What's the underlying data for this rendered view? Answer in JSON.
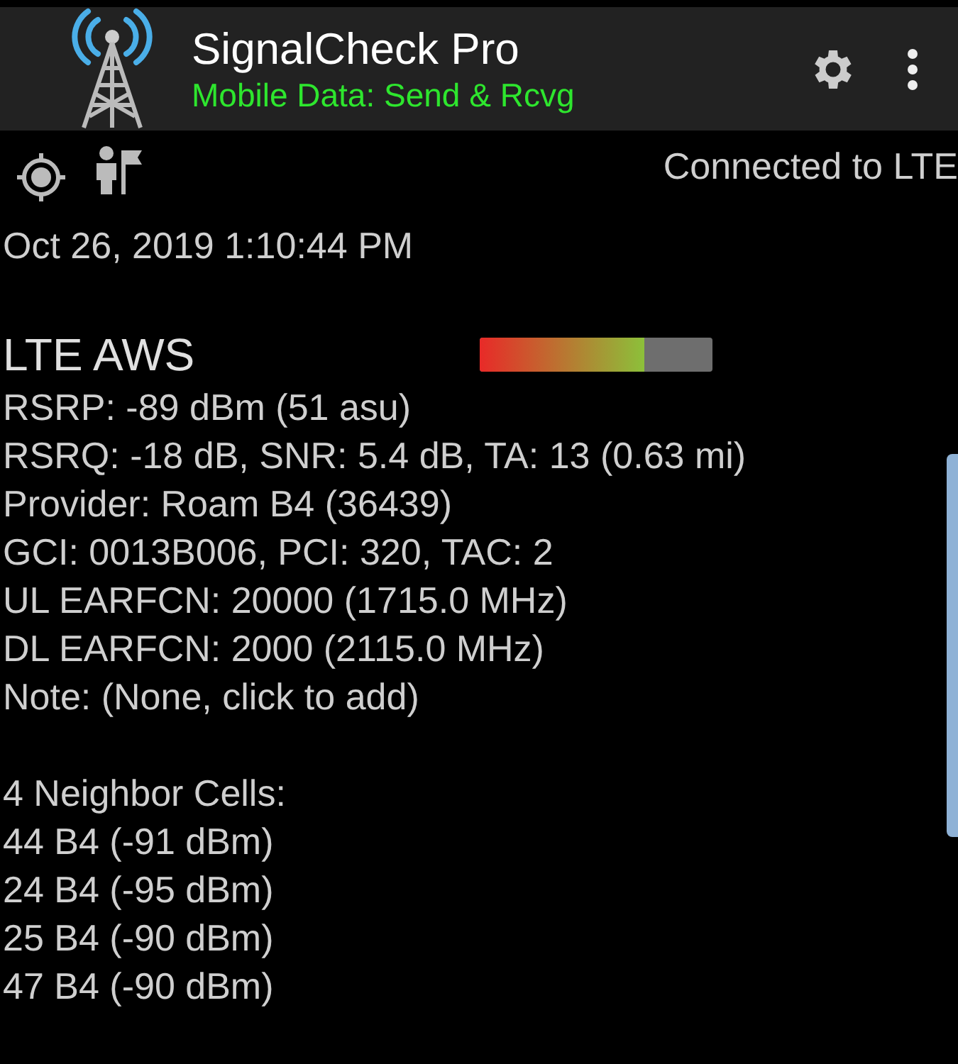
{
  "app_bar": {
    "title": "SignalCheck Pro",
    "subtitle": "Mobile Data: Send & Rcvg"
  },
  "status": {
    "connection": "Connected to LTE",
    "timestamp": "Oct 26, 2019 1:10:44 PM"
  },
  "cell": {
    "band": "LTE AWS",
    "signal": {
      "level": 0.71
    },
    "details": [
      "RSRP: -89 dBm (51 asu)",
      "RSRQ: -18 dB, SNR: 5.4 dB, TA: 13 (0.63 mi)",
      "Provider: Roam B4 (36439)",
      "GCI: 0013B006, PCI: 320, TAC: 2",
      "UL EARFCN: 20000 (1715.0 MHz)",
      "DL EARFCN: 2000 (2115.0 MHz)",
      "Note: (None, click to add)"
    ]
  },
  "neighbors": {
    "heading": "4 Neighbor Cells:",
    "items": [
      "44 B4 (-91 dBm)",
      "24 B4 (-95 dBm)",
      "25 B4 (-90 dBm)",
      "47 B4 (-90 dBm)"
    ]
  }
}
